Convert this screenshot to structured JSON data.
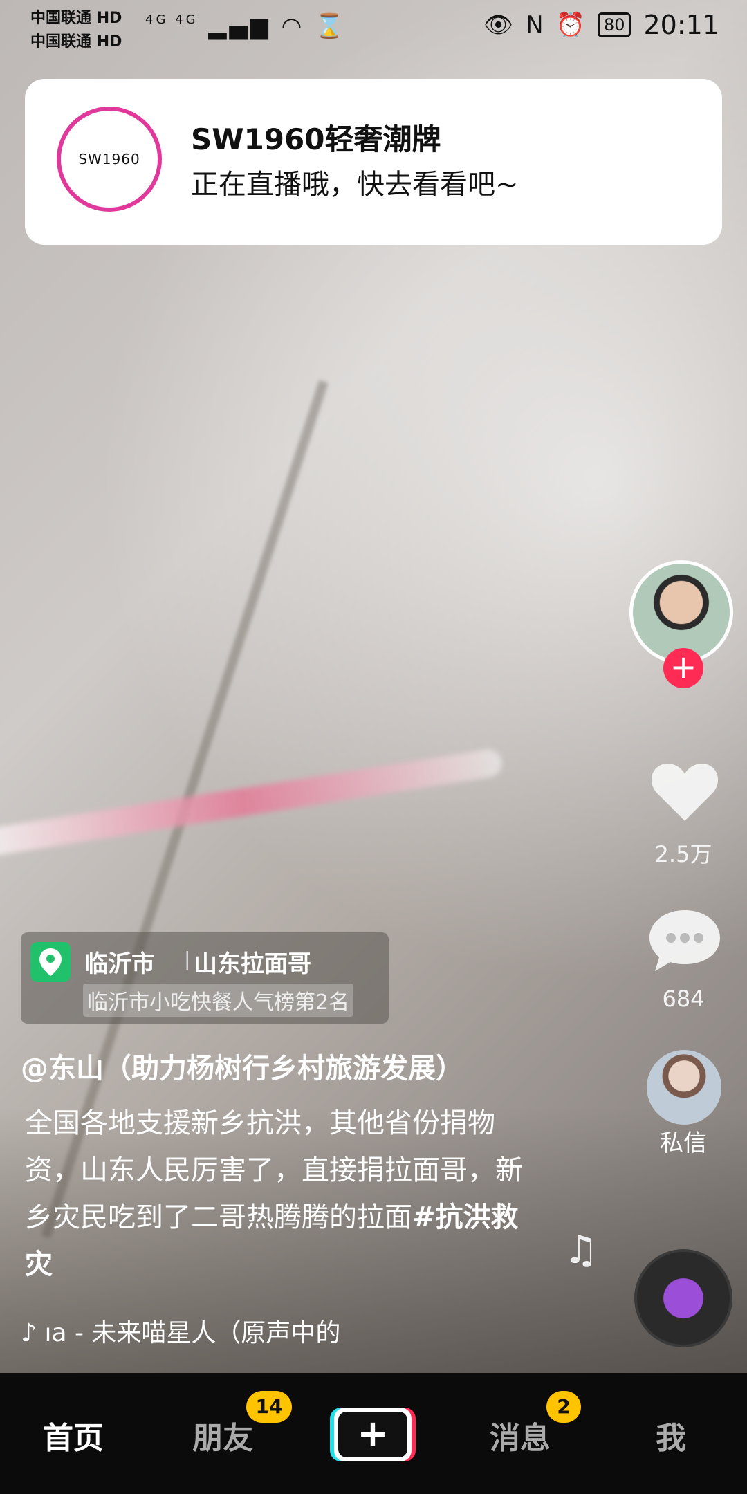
{
  "status_bar": {
    "carrier_1": "中国联通",
    "carrier_2": "中国联通",
    "hd_1": "HD",
    "hd_2": "HD",
    "signal_text": "4G 4G",
    "battery": "80",
    "time": "20:11"
  },
  "notification": {
    "title": "SW1960轻奢潮牌",
    "body": "正在直播哦，快去看看吧~",
    "logo_text": "SW1960"
  },
  "actions": {
    "likes": "2.5万",
    "comments": "684",
    "dm_label": "私信"
  },
  "location": {
    "city": "临沂市",
    "separator": "|",
    "shop": "山东拉面哥",
    "rank": "临沂市小吃快餐人气榜第2名"
  },
  "post": {
    "author": "@东山（助力杨树行乡村旅游发展）",
    "caption": "全国各地支援新乡抗洪，其他省份捐物资，山东人民厉害了，直接捐拉面哥，新乡灾民吃到了二哥热腾腾的拉面",
    "hashtag": "#抗洪救灾",
    "music": "ıa - 未来喵星人（原声中的"
  },
  "nav": {
    "home": "首页",
    "friends": "朋友",
    "friends_badge": "14",
    "plus": "+",
    "messages": "消息",
    "messages_badge": "2",
    "me": "我"
  },
  "colors": {
    "accent_red": "#fe2c55",
    "accent_cyan": "#23e0e8",
    "badge_yellow": "#ffc300",
    "location_green": "#21c16b",
    "logo_pink": "#e0399b"
  }
}
